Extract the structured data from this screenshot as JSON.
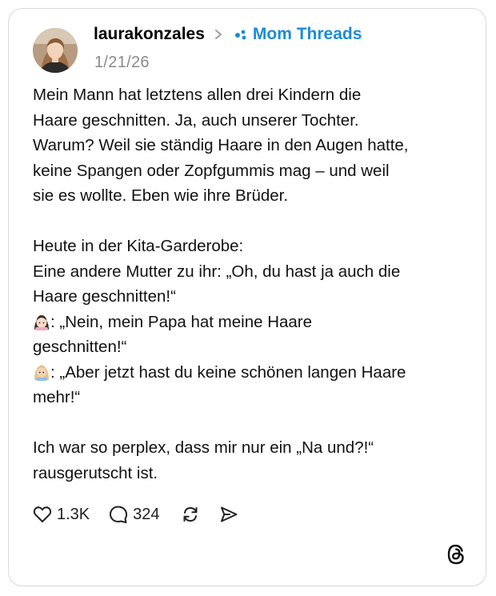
{
  "post": {
    "username": "laurakonzales",
    "community": "Mom Threads",
    "date": "1/21/26",
    "body": {
      "line1": "Mein Mann hat letztens allen drei Kindern die",
      "line2": "Haare geschnitten. Ja, auch unserer Tochter.",
      "line3": "Warum? Weil sie ständig Haare in den Augen hatte,",
      "line4": "keine Spangen oder Zopfgummis mag – und weil",
      "line5": "sie es wollte. Eben wie ihre Brüder.",
      "line6": "Heute in der Kita-Garderobe:",
      "line7": "Eine andere Mutter zu ihr: „Oh, du hast ja auch die",
      "line8": "Haare geschnitten!“",
      "line9": ": „Nein, mein Papa hat meine Haare",
      "line10": "geschnitten!“",
      "line11": ": „Aber jetzt hast du keine schönen langen Haare",
      "line12": "mehr!“",
      "line13": "Ich war so perplex, dass mir nur ein „Na und?!“",
      "line14": "rausgerutscht ist."
    },
    "stats": {
      "likes": "1.3K",
      "replies": "324"
    }
  },
  "icons": {
    "chevron": "chevron-right-icon",
    "community": "community-dots-icon",
    "like": "heart-icon",
    "reply": "comment-icon",
    "repost": "repost-icon",
    "share": "send-icon",
    "brand": "threads-logo-icon",
    "emoji_girl": "girl-emoji",
    "emoji_woman": "woman-emoji"
  },
  "colors": {
    "community": "#1a8cd8",
    "timestamp": "#8a8a8a",
    "border": "#d9d9d9"
  }
}
